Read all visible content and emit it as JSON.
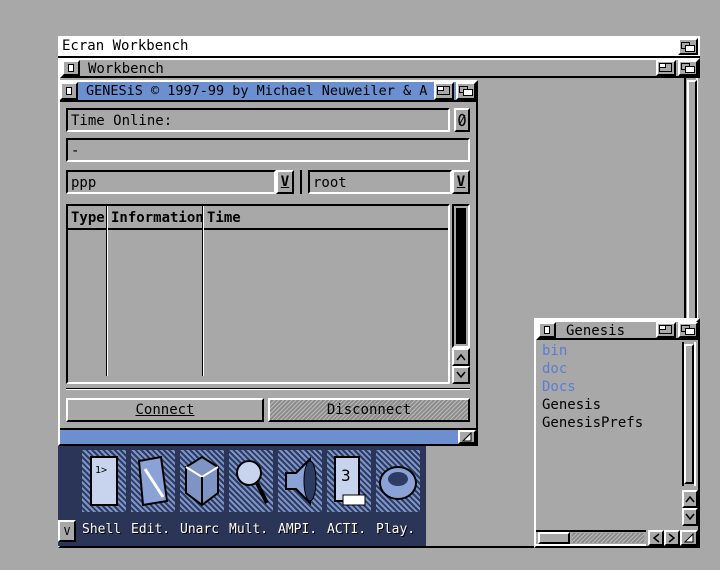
{
  "screen": {
    "title": "Ecran Workbench",
    "depth_icon": "depth-arrange-icon"
  },
  "workbench_window": {
    "title": "Workbench",
    "close_icon": "close-icon"
  },
  "genesis_main": {
    "title": "GENESiS © 1997-99 by Michael Neuweiler & A",
    "time_online_label": "Time Online:",
    "time_online_value": "",
    "info_line": "-",
    "interface_value": "ppp",
    "user_value": "root",
    "dropdown_glyph": "V",
    "log_table": {
      "columns": [
        "Type",
        "Information",
        "Time"
      ],
      "rows": []
    },
    "connect_label": "Connect",
    "disconnect_label": "Disconnect"
  },
  "genesis_drawer": {
    "title": "Genesis",
    "items": [
      {
        "label": "bin",
        "kind": "drawer"
      },
      {
        "label": "doc",
        "kind": "drawer"
      },
      {
        "label": "Docs",
        "kind": "drawer"
      },
      {
        "label": "Genesis",
        "kind": "file"
      },
      {
        "label": "GenesisPrefs",
        "kind": "file"
      }
    ]
  },
  "dock": {
    "items": [
      {
        "label": "Shell",
        "icon": "shell-icon"
      },
      {
        "label": "Edit.",
        "icon": "edit-pencil-icon"
      },
      {
        "label": "Unarc",
        "icon": "unarc-box-icon"
      },
      {
        "label": "Mult.",
        "icon": "magnifier-icon"
      },
      {
        "label": "AMPI.",
        "icon": "speaker-icon"
      },
      {
        "label": "ACTI.",
        "icon": "document-icon"
      },
      {
        "label": "Play.",
        "icon": "disk-icon"
      }
    ]
  },
  "colors": {
    "grey": "#a8a8a8",
    "blue": "#6b8fcf",
    "drawer_blue": "#5b7ed0"
  }
}
